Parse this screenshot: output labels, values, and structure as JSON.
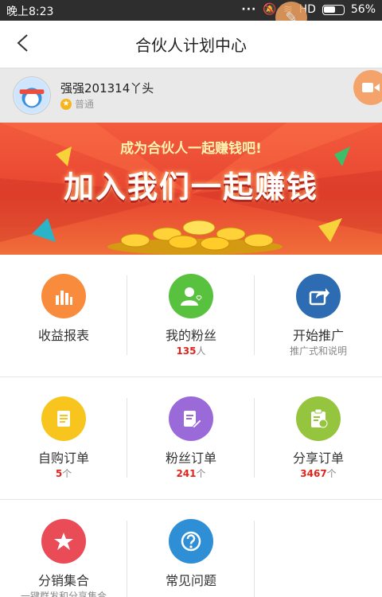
{
  "status_bar": {
    "time": "晚上8:23",
    "network": "HD",
    "battery": "56%"
  },
  "header": {
    "title": "合伙人计划中心"
  },
  "profile": {
    "username": "强强201314丫头",
    "level": "普通"
  },
  "banner": {
    "subtitle": "成为合伙人一起赚钱吧!",
    "headline": "加入我们一起赚钱"
  },
  "grid": {
    "revenue": {
      "label": "收益报表"
    },
    "fans": {
      "label": "我的粉丝",
      "count": "135",
      "unit": "人"
    },
    "promote": {
      "label": "开始推广",
      "desc": "推广式和说明"
    },
    "self_orders": {
      "label": "自购订单",
      "count": "5",
      "unit": "个"
    },
    "fan_orders": {
      "label": "粉丝订单",
      "count": "241",
      "unit": "个"
    },
    "share_orders": {
      "label": "分享订单",
      "count": "3467",
      "unit": "个"
    },
    "distribution": {
      "label": "分销集合",
      "desc": "一键群发和分享集合"
    },
    "faq": {
      "label": "常见问题"
    }
  },
  "colors": {
    "revenue": "#f98b3d",
    "fans": "#58c23e",
    "promote": "#2d6bb3",
    "self_orders": "#f7c51d",
    "fan_orders": "#9b6ad9",
    "share_orders": "#95c43f",
    "distribution": "#e94b57",
    "faq": "#2f8fd6"
  }
}
